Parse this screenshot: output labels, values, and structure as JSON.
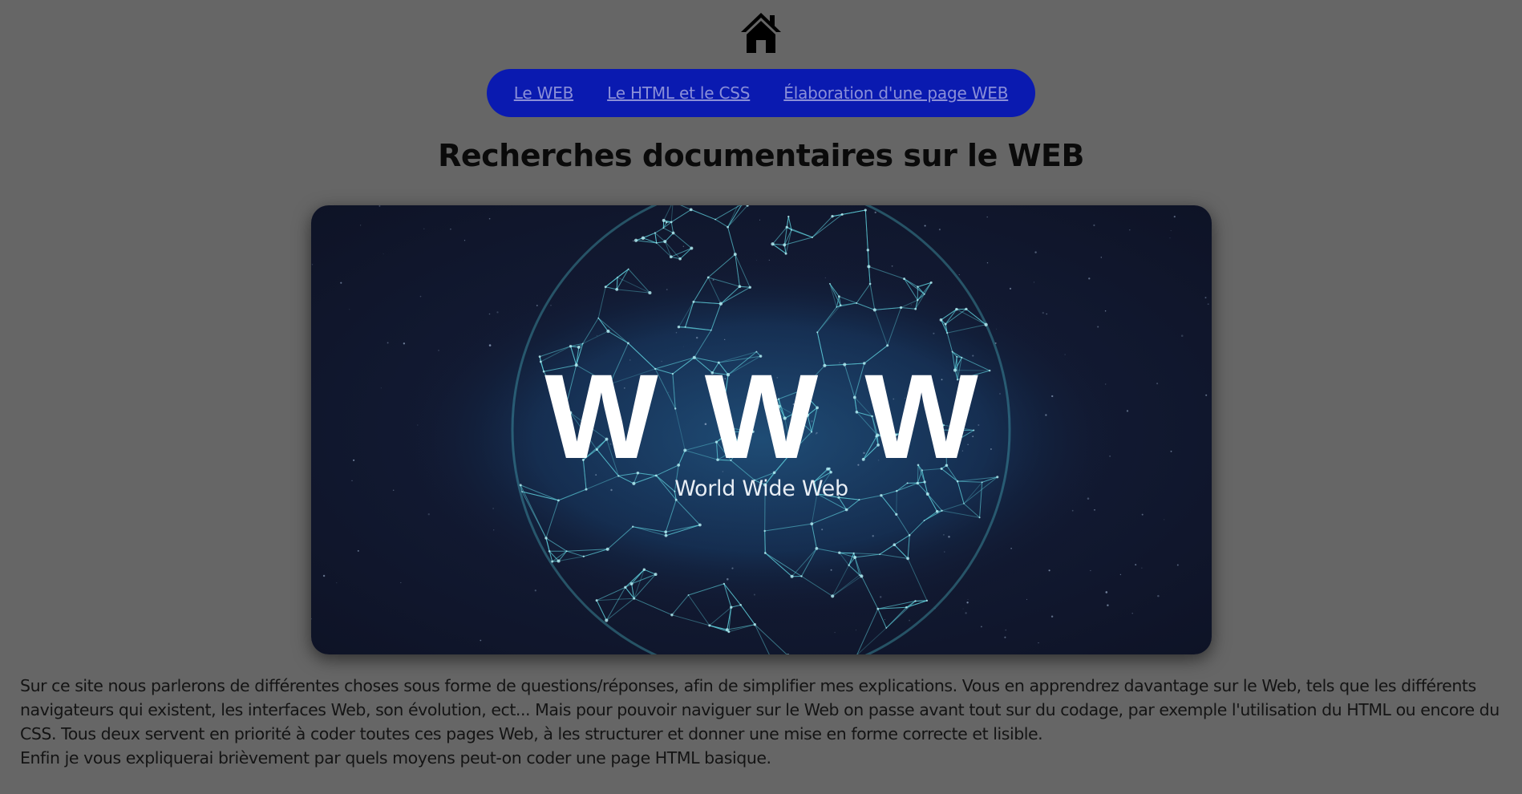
{
  "header": {
    "home_icon": "home-icon"
  },
  "nav": {
    "background": "#0a1ab0",
    "link_color": "#8a8fd8",
    "items": [
      {
        "label": "Le WEB"
      },
      {
        "label": "Le HTML et le CSS"
      },
      {
        "label": "Élaboration d'une page WEB"
      }
    ]
  },
  "main": {
    "title": "Recherches documentaires sur le WEB",
    "hero_image": {
      "headline": "WWW",
      "subtitle": "World Wide Web"
    },
    "paragraph_1": "Sur ce site nous parlerons de différentes choses sous forme de questions/réponses, afin de simplifier mes explications. Vous en apprendrez davantage sur le Web, tels que les différents navigateurs qui existent, les interfaces Web, son évolution, ect... Mais pour pouvoir naviguer sur le Web on passe avant tout sur du codage, par exemple l'utilisation du HTML ou encore du CSS. Tous deux servent en priorité à coder toutes ces pages Web, à les structurer et donner une mise en forme correcte et lisible.",
    "paragraph_2": "Enfin je vous expliquerai brièvement par quels moyens peut-on coder une page HTML basique."
  },
  "colors": {
    "page_background": "#666666",
    "globe_line": "#5fd0dc"
  }
}
